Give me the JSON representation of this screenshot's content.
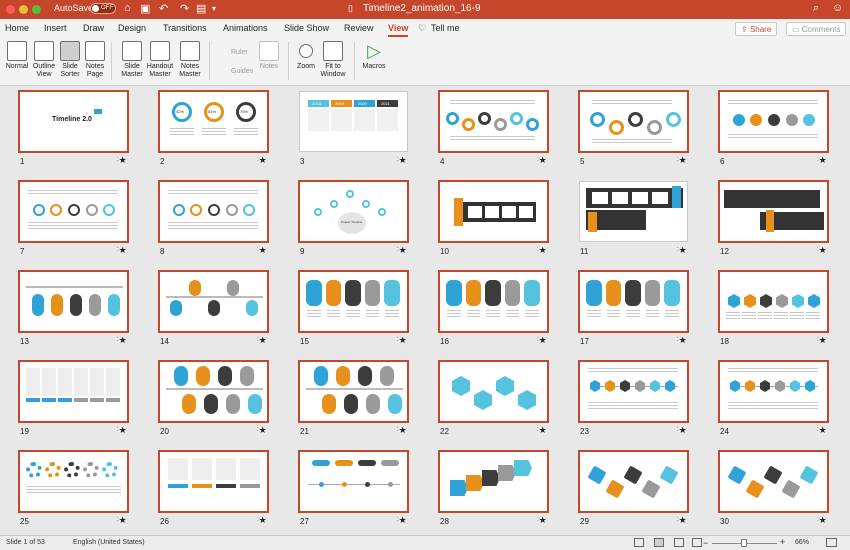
{
  "titlebar": {
    "autosave_label": "AutoSave",
    "toggle_state": "OFF",
    "document_title": "Timeline2_animation_16-9"
  },
  "ribbon": {
    "tabs": [
      "Home",
      "Insert",
      "Draw",
      "Design",
      "Transitions",
      "Animations",
      "Slide Show",
      "Review",
      "View",
      "Tell me"
    ],
    "active_tab": "View",
    "share_label": "Share",
    "comments_label": "Comments",
    "groups": [
      {
        "id": "normal",
        "label": "Normal"
      },
      {
        "id": "outline",
        "label": "Outline View"
      },
      {
        "id": "sorter",
        "label": "Slide Sorter"
      },
      {
        "id": "notes-page",
        "label": "Notes Page"
      },
      {
        "id": "slide-master",
        "label": "Slide Master"
      },
      {
        "id": "handout-master",
        "label": "Handout Master"
      },
      {
        "id": "notes-master",
        "label": "Notes Master"
      },
      {
        "id": "ruler",
        "label": "Ruler"
      },
      {
        "id": "guides",
        "label": "Guides"
      },
      {
        "id": "notes",
        "label": "Notes"
      },
      {
        "id": "zoom",
        "label": "Zoom"
      },
      {
        "id": "fit",
        "label": "Fit to Window"
      },
      {
        "id": "macros",
        "label": "Macros"
      }
    ]
  },
  "slides": [
    {
      "number": "1",
      "selected": true,
      "title": "Timeline 2.0"
    },
    {
      "number": "2",
      "selected": true
    },
    {
      "number": "3",
      "selected": false
    },
    {
      "number": "4",
      "selected": true
    },
    {
      "number": "5",
      "selected": true
    },
    {
      "number": "6",
      "selected": true
    },
    {
      "number": "7",
      "selected": true
    },
    {
      "number": "8",
      "selected": true
    },
    {
      "number": "9",
      "selected": true
    },
    {
      "number": "10",
      "selected": true
    },
    {
      "number": "11",
      "selected": false
    },
    {
      "number": "12",
      "selected": true
    },
    {
      "number": "13",
      "selected": true
    },
    {
      "number": "14",
      "selected": true
    },
    {
      "number": "15",
      "selected": true
    },
    {
      "number": "16",
      "selected": true
    },
    {
      "number": "17",
      "selected": true
    },
    {
      "number": "18",
      "selected": true
    },
    {
      "number": "19",
      "selected": true
    },
    {
      "number": "20",
      "selected": true
    },
    {
      "number": "21",
      "selected": true
    },
    {
      "number": "22",
      "selected": true
    },
    {
      "number": "23",
      "selected": true
    },
    {
      "number": "24",
      "selected": true
    },
    {
      "number": "25",
      "selected": true
    },
    {
      "number": "26",
      "selected": true
    },
    {
      "number": "27",
      "selected": true
    },
    {
      "number": "28",
      "selected": true
    },
    {
      "number": "29",
      "selected": true
    },
    {
      "number": "30",
      "selected": true
    }
  ],
  "slide_texts": {
    "slide2_pcts": [
      "42%",
      "61%",
      "75%"
    ],
    "slide3_years": [
      "2018",
      "2019",
      "2020",
      "2021"
    ],
    "slide9_center": "Project Timeline"
  },
  "status": {
    "slide_info": "Slide 1 of 53",
    "language": "English (United States)",
    "zoom": "66%"
  },
  "colors": {
    "accent": "#c6462b",
    "blue": "#2fa3d6",
    "orange": "#e8901c",
    "dark": "#3c3c3c",
    "gray": "#9a9a9a",
    "teal": "#55c2e0"
  }
}
